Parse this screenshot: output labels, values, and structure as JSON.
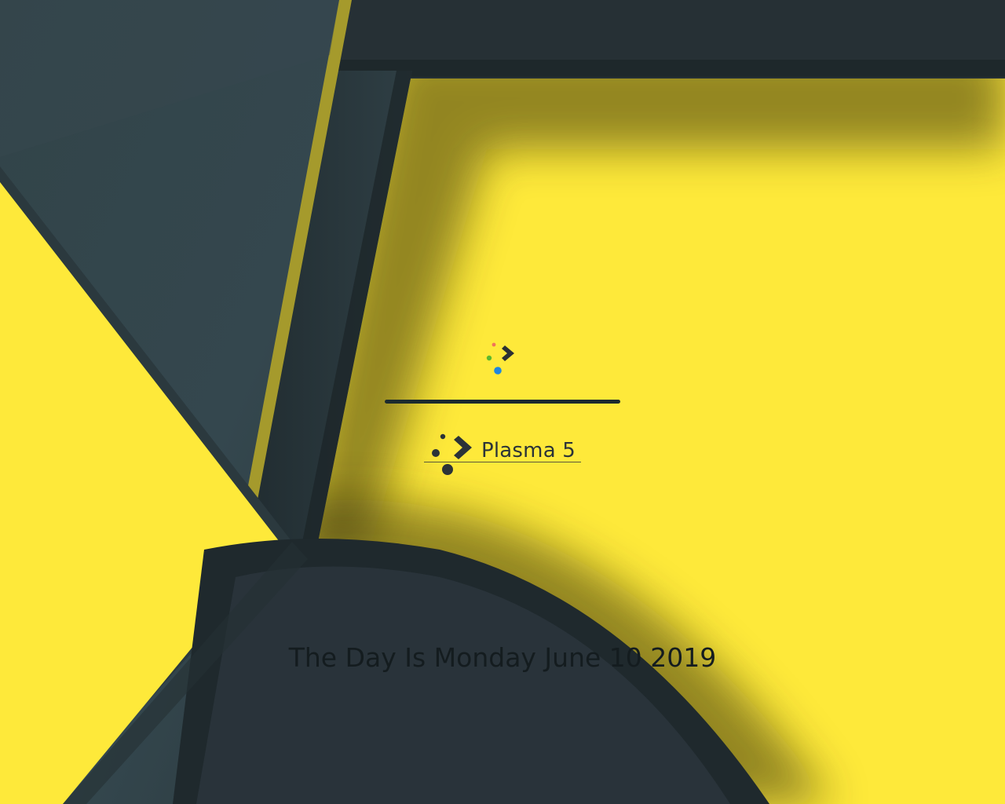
{
  "splash": {
    "brand_label": "Plasma 5",
    "date_line": "The Day Is Monday June 10 2019",
    "progress_fraction": 1.0
  },
  "colors": {
    "wallpaper_yellow": "#fee93a",
    "wallpaper_dark": "#2a3439",
    "wallpaper_slate": "#33454c",
    "wallpaper_olive": "#a59a2c",
    "progress_bar": "#1c2b2e",
    "text_dark": "#141c1f"
  },
  "icons": {
    "splash_logo": "kde-plasma-logo-icon",
    "brand_logo": "plasma-logo-icon"
  }
}
